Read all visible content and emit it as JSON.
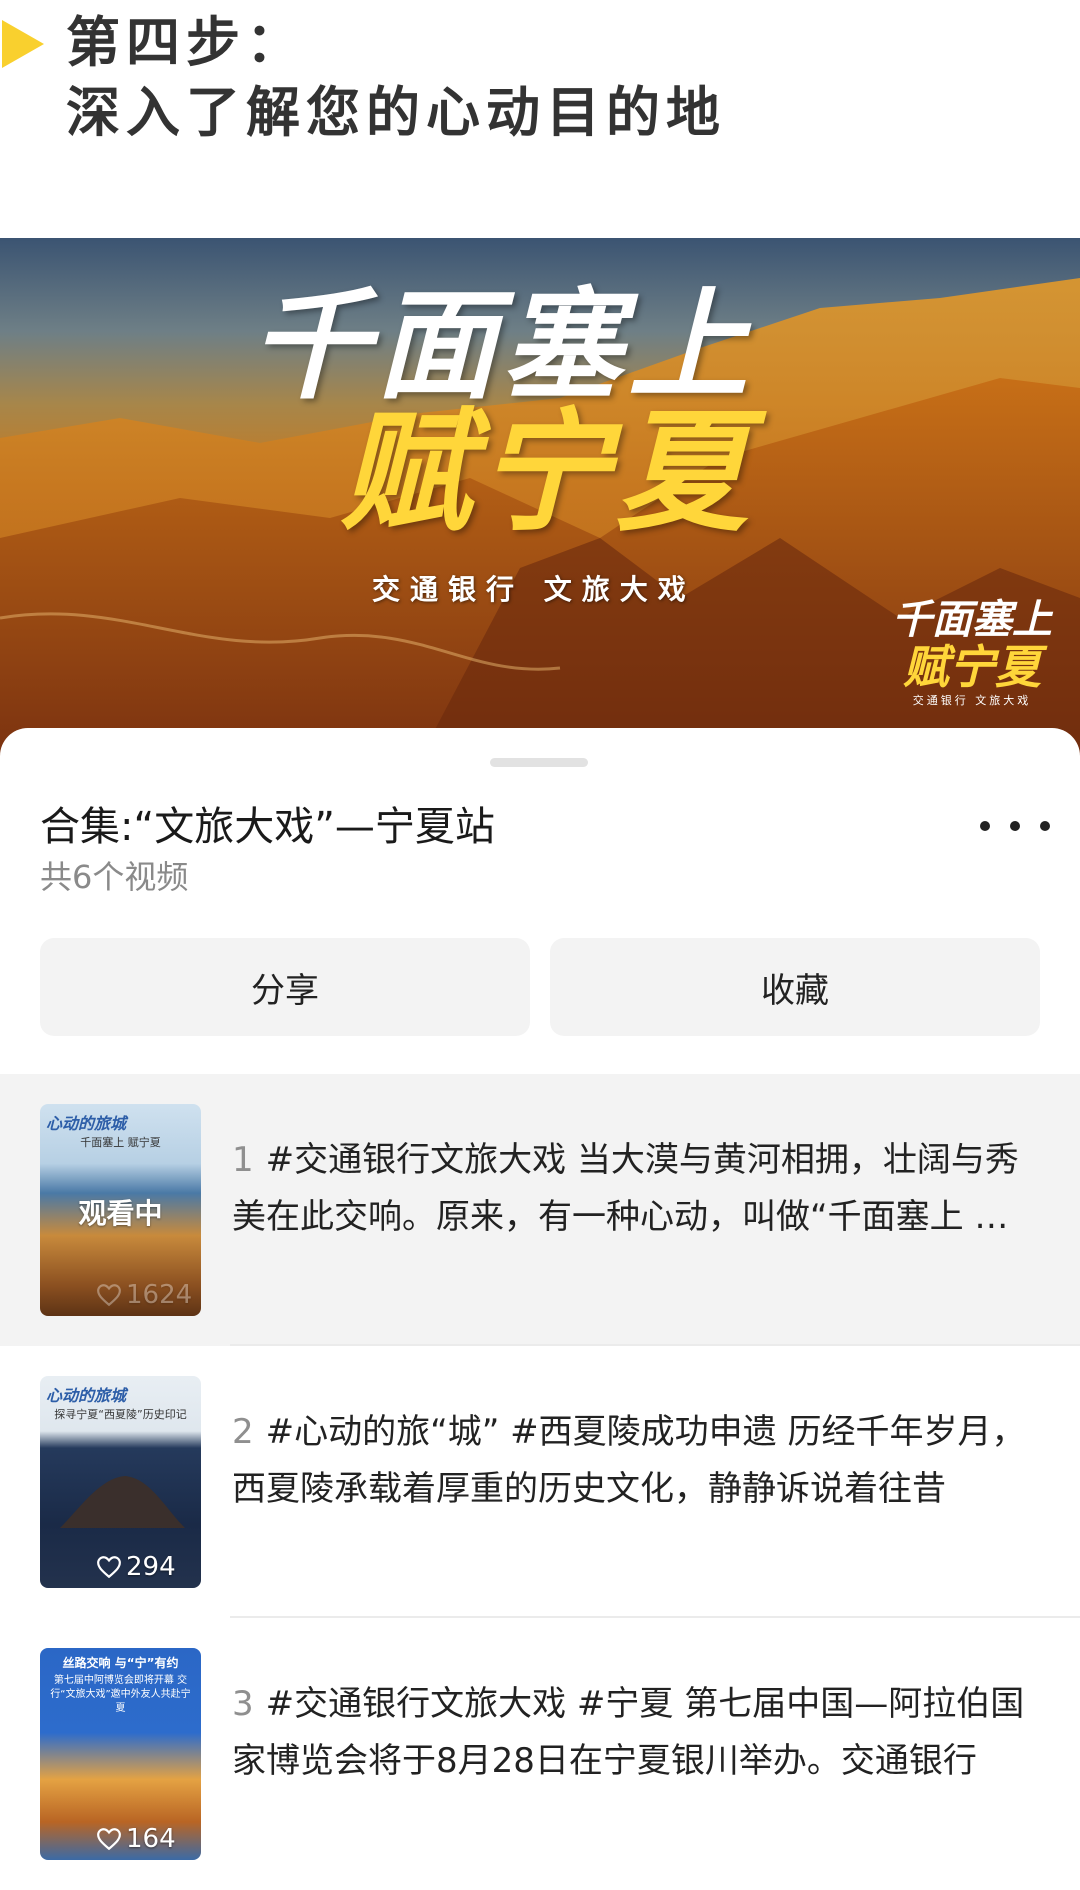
{
  "header": {
    "line1": "第四步：",
    "line2": "深入了解您的心动目的地"
  },
  "hero": {
    "title_line1": "千面塞上",
    "title_line2": "赋宁夏",
    "subtitle": "交通银行  文旅大戏",
    "logo_line1": "千面塞上",
    "logo_line2": "赋宁夏",
    "logo_line3": "交通银行  文旅大戏"
  },
  "sheet": {
    "title": "合集:“文旅大戏”—宁夏站",
    "count": "共6个视频",
    "share_label": "分享",
    "favorite_label": "收藏"
  },
  "videos": [
    {
      "index": "1",
      "text": "#交通银行文旅大戏 当大漠与黄河相拥，壮阔与秀美在此交响。原来，有一种心动，叫做“千面塞上 赋宁夏”",
      "thumb_head": "心动的旅城",
      "thumb_sub": "千面塞上 赋宁夏",
      "status": "观看中",
      "likes": "1624"
    },
    {
      "index": "2",
      "text": "#心动的旅“城” #西夏陵成功申遗 历经千年岁月，西夏陵承载着厚重的历史文化，静静诉说着往昔",
      "thumb_head": "心动的旅城",
      "thumb_sub": "探寻宁夏“西夏陵”历史印记",
      "status": "",
      "likes": "294"
    },
    {
      "index": "3",
      "text": "#交通银行文旅大戏 #宁夏 第七届中国—阿拉伯国家博览会将于8月28日在宁夏银川举办。交通银行",
      "thumb_head": "丝路交响 与“宁”有约",
      "thumb_sub": "第七届中阿博览会即将开幕 交行“文旅大戏”邀中外友人共赴宁夏",
      "status": "",
      "likes": "164"
    }
  ],
  "colors": {
    "accent_yellow": "#F9D02E",
    "button_bg": "#f3f3f3",
    "active_row_bg": "#f3f3f3"
  }
}
